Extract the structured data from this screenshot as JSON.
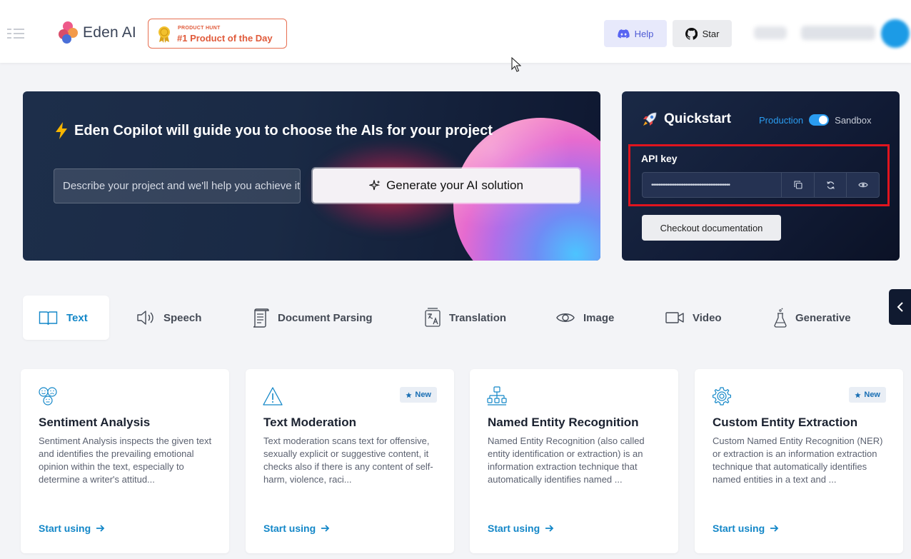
{
  "header": {
    "logo_text": "Eden AI",
    "product_hunt_small": "PRODUCT HUNT",
    "product_hunt_big": "#1 Product of the Day",
    "help_label": "Help",
    "star_label": "Star"
  },
  "copilot": {
    "title": "Eden Copilot will guide you to choose the AIs for your project",
    "input_placeholder": "Describe your project and we'll help you achieve it",
    "generate_label": "Generate your AI solution"
  },
  "quickstart": {
    "title": "Quickstart",
    "env_production": "Production",
    "env_sandbox": "Sandbox",
    "api_key_label": "API key",
    "api_key_value": "••••••••••••••••••••••••••••••••••••••••••••",
    "checkout_label": "Checkout documentation"
  },
  "tabs": [
    {
      "label": "Text",
      "icon": "book-icon"
    },
    {
      "label": "Speech",
      "icon": "speaker-icon"
    },
    {
      "label": "Document Parsing",
      "icon": "document-icon"
    },
    {
      "label": "Translation",
      "icon": "translate-icon"
    },
    {
      "label": "Image",
      "icon": "eye-icon"
    },
    {
      "label": "Video",
      "icon": "video-camera-icon"
    },
    {
      "label": "Generative",
      "icon": "flask-icon"
    }
  ],
  "cards": [
    {
      "title": "Sentiment Analysis",
      "badge": "",
      "description": "Sentiment Analysis inspects the given text and identifies the prevailing emotional opinion within the text, especially to determine a writer's attitud...",
      "link": "Start using"
    },
    {
      "title": "Text Moderation",
      "badge": "New",
      "description": "Text moderation scans text for offensive, sexually explicit or suggestive content, it checks also if there is any content of self-harm, violence, raci...",
      "link": "Start using"
    },
    {
      "title": "Named Entity Recognition",
      "badge": "",
      "description": "Named Entity Recognition (also called entity identification or extraction) is an information extraction technique that automatically identifies named ...",
      "link": "Start using"
    },
    {
      "title": "Custom Entity Extraction",
      "badge": "New",
      "description": "Custom Named Entity Recognition (NER) or extraction is an information extraction technique that automatically identifies named entities in a text and ...",
      "link": "Start using"
    }
  ],
  "colors": {
    "accent": "#1387c8",
    "highlight_border": "#e0141e",
    "product_hunt": "#e05a3a",
    "discord": "#4f5bd5"
  }
}
